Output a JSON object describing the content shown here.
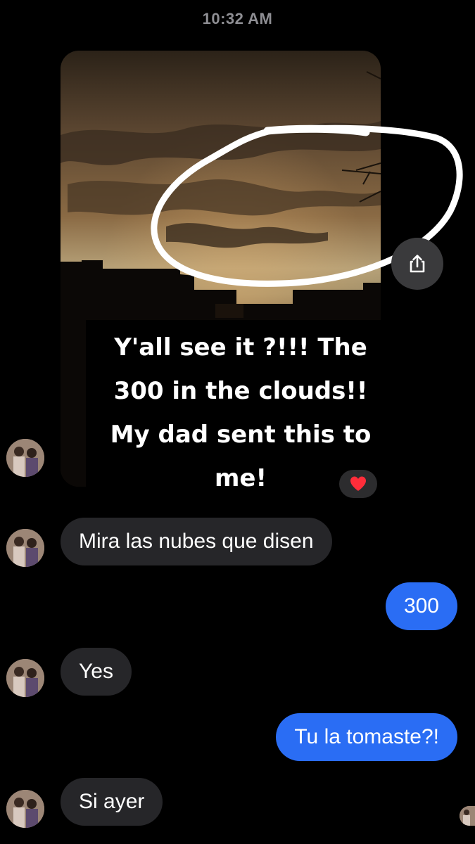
{
  "header": {
    "timestamp": "10:32 AM"
  },
  "photo": {
    "caption_lines": [
      "Y'all see it ?!!! The",
      "300 in the clouds!!",
      "My dad sent this to",
      "me!"
    ]
  },
  "reaction": {
    "emoji": "❤️"
  },
  "messages": [
    {
      "direction": "incoming",
      "text": "Mira las nubes que disen"
    },
    {
      "direction": "outgoing",
      "text": "300"
    },
    {
      "direction": "incoming",
      "text": "Yes"
    },
    {
      "direction": "outgoing",
      "text": "Tu la tomaste?!"
    },
    {
      "direction": "incoming",
      "text": "Si ayer"
    }
  ],
  "icons": {
    "share": "share-icon",
    "avatar": "avatar"
  },
  "colors": {
    "outgoing_bubble": "#2a6df4",
    "incoming_bubble": "#262629",
    "background": "#000000",
    "timestamp": "#8e8e93",
    "annotation_circle": "#ffffff"
  }
}
